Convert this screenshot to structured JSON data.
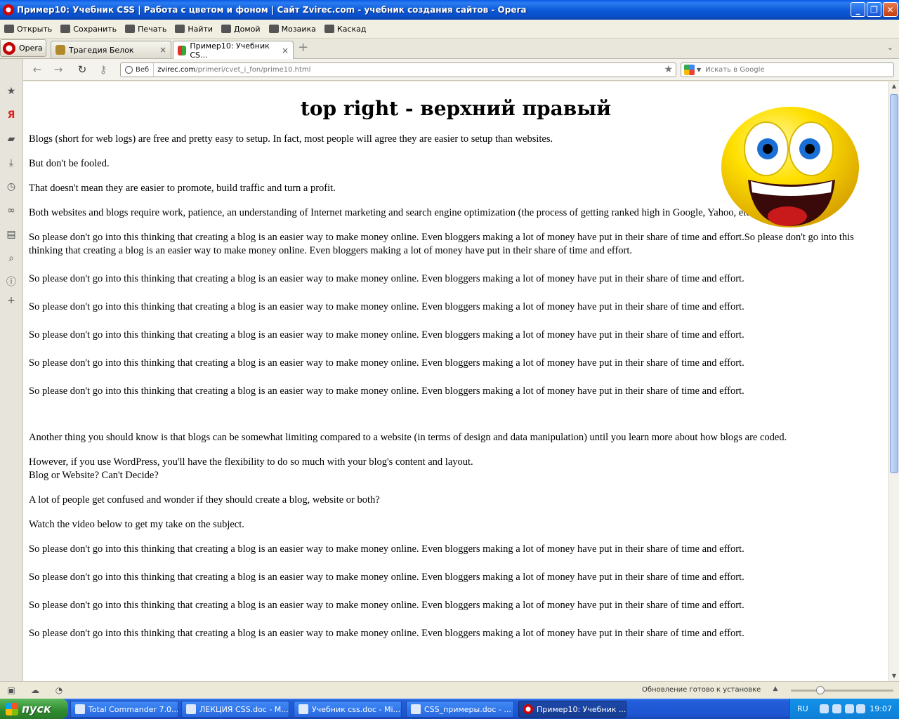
{
  "window": {
    "title": "Пример10: Учебник CSS | Работа с цветом и фоном | Сайт Zvirec.com - учебник создания сайтов - Opera",
    "minimize": "_",
    "maximize": "❐",
    "close": "✕"
  },
  "toolbar": {
    "open": "Открыть",
    "save": "Сохранить",
    "print": "Печать",
    "find": "Найти",
    "home": "Домой",
    "tile": "Мозаика",
    "cascade": "Каскад"
  },
  "tabs": {
    "opera_menu": "Opera",
    "items": [
      {
        "label": "Трагедия Белок",
        "close": "×"
      },
      {
        "label": "Пример10: Учебник CS...",
        "close": "×"
      }
    ],
    "add": "+"
  },
  "address": {
    "badge": "Веб",
    "url_domain": "zvirec.com",
    "url_path": "/primeri/cvet_i_fon/prime10.html",
    "search_placeholder": "Искать в Google"
  },
  "page": {
    "title": "top right - верхний правый",
    "paragraphs_top": [
      "Blogs (short for web logs) are free and pretty easy to setup. In fact, most people will agree they are easier to setup than websites.",
      "But don't be fooled.",
      "That doesn't mean they are easier to promote, build traffic and turn a profit.",
      "Both websites and blogs require work, patience, an understanding of Internet marketing and search engine optimization (the process of getting ranked high in Google, Yahoo, etc.)",
      "So please don't go into this thinking that creating a blog is an easier way to make money online. Even bloggers making a lot of money have put in their share of time and effort.So please don't go into this thinking that creating a blog is an easier way to make money online. Even bloggers making a lot of money have put in their share of time and effort."
    ],
    "repeat_line": "So please don't go into this thinking that creating a blog is an easier way to make money online. Even bloggers making a lot of money have put in their share of time and effort.",
    "paragraphs_mid": [
      "Another thing you should know is that blogs can be somewhat limiting compared to a website (in terms of design and data manipulation) until you learn more about how blogs are coded."
    ],
    "wordpress_line1": "However, if you use WordPress, you'll have the flexibility to do so much with your blog's content and layout.",
    "wordpress_line2": "Blog or Website? Can't Decide?",
    "confused": "A lot of people get confused and wonder if they should create a blog, website or both?",
    "watch": "Watch the video below to get my take on the subject."
  },
  "status": {
    "update": "Обновление готово к установке"
  },
  "taskbar": {
    "start": "пуск",
    "tasks": [
      "Total Commander 7.0...",
      "ЛЕКЦИЯ CSS.doc - M...",
      "Учебник css.doc - Mi...",
      "CSS_примеры.doc - ...",
      "Пример10: Учебник ..."
    ],
    "lang": "RU",
    "clock": "19:07"
  }
}
